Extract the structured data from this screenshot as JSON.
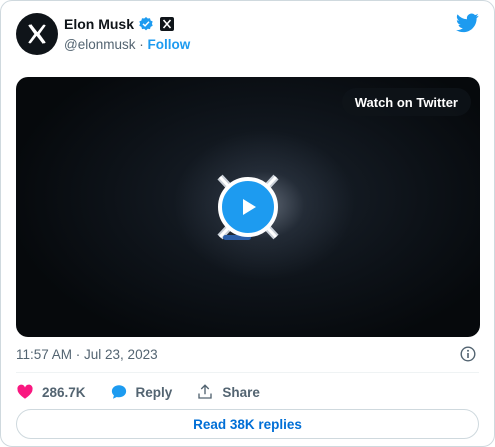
{
  "author": {
    "name": "Elon Musk",
    "handle": "@elonmusk",
    "separator": " · ",
    "follow_label": "Follow",
    "avatar_icon": "x-logo-icon",
    "verified_icon": "verified-badge-icon",
    "affiliation_icon": "x-affiliate-badge-icon"
  },
  "brand": {
    "icon": "twitter-bird-icon",
    "color": "#1d9bf0"
  },
  "video": {
    "watch_label": "Watch on Twitter",
    "play_icon": "play-icon"
  },
  "meta": {
    "timestamp": "11:57 AM · Jul 23, 2023",
    "info_icon": "info-icon"
  },
  "actions": {
    "likes": "286.7K",
    "reply_label": "Reply",
    "share_label": "Share"
  },
  "replies_button": "Read 38K replies",
  "colors": {
    "like": "#f91880",
    "reply": "#1d9bf0",
    "link": "#006fd6"
  }
}
